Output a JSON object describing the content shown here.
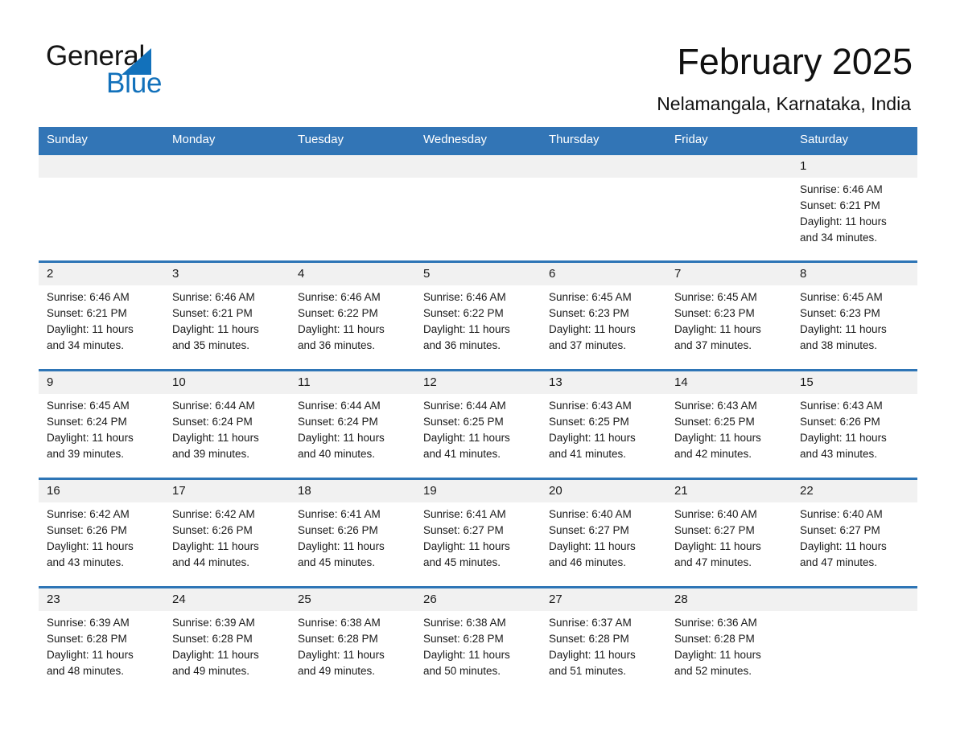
{
  "logo": {
    "word_one": "General",
    "word_two": "Blue",
    "triangle_color": "#1271bb"
  },
  "header": {
    "title": "February 2025",
    "subtitle": "Nelamangala, Karnataka, India",
    "accent_color": "#3275b6",
    "daynum_bg": "#f1f1f1"
  },
  "weekday_headers": [
    "Sunday",
    "Monday",
    "Tuesday",
    "Wednesday",
    "Thursday",
    "Friday",
    "Saturday"
  ],
  "labels": {
    "sunrise_prefix": "Sunrise:",
    "sunset_prefix": "Sunset:",
    "daylight_prefix": "Daylight:"
  },
  "weeks": [
    [
      {
        "day": "",
        "blank": true
      },
      {
        "day": "",
        "blank": true
      },
      {
        "day": "",
        "blank": true
      },
      {
        "day": "",
        "blank": true
      },
      {
        "day": "",
        "blank": true
      },
      {
        "day": "",
        "blank": true
      },
      {
        "day": "1",
        "sunrise": "Sunrise: 6:46 AM",
        "sunset": "Sunset: 6:21 PM",
        "daylight_l1": "Daylight: 11 hours",
        "daylight_l2": "and 34 minutes."
      }
    ],
    [
      {
        "day": "2",
        "sunrise": "Sunrise: 6:46 AM",
        "sunset": "Sunset: 6:21 PM",
        "daylight_l1": "Daylight: 11 hours",
        "daylight_l2": "and 34 minutes."
      },
      {
        "day": "3",
        "sunrise": "Sunrise: 6:46 AM",
        "sunset": "Sunset: 6:21 PM",
        "daylight_l1": "Daylight: 11 hours",
        "daylight_l2": "and 35 minutes."
      },
      {
        "day": "4",
        "sunrise": "Sunrise: 6:46 AM",
        "sunset": "Sunset: 6:22 PM",
        "daylight_l1": "Daylight: 11 hours",
        "daylight_l2": "and 36 minutes."
      },
      {
        "day": "5",
        "sunrise": "Sunrise: 6:46 AM",
        "sunset": "Sunset: 6:22 PM",
        "daylight_l1": "Daylight: 11 hours",
        "daylight_l2": "and 36 minutes."
      },
      {
        "day": "6",
        "sunrise": "Sunrise: 6:45 AM",
        "sunset": "Sunset: 6:23 PM",
        "daylight_l1": "Daylight: 11 hours",
        "daylight_l2": "and 37 minutes."
      },
      {
        "day": "7",
        "sunrise": "Sunrise: 6:45 AM",
        "sunset": "Sunset: 6:23 PM",
        "daylight_l1": "Daylight: 11 hours",
        "daylight_l2": "and 37 minutes."
      },
      {
        "day": "8",
        "sunrise": "Sunrise: 6:45 AM",
        "sunset": "Sunset: 6:23 PM",
        "daylight_l1": "Daylight: 11 hours",
        "daylight_l2": "and 38 minutes."
      }
    ],
    [
      {
        "day": "9",
        "sunrise": "Sunrise: 6:45 AM",
        "sunset": "Sunset: 6:24 PM",
        "daylight_l1": "Daylight: 11 hours",
        "daylight_l2": "and 39 minutes."
      },
      {
        "day": "10",
        "sunrise": "Sunrise: 6:44 AM",
        "sunset": "Sunset: 6:24 PM",
        "daylight_l1": "Daylight: 11 hours",
        "daylight_l2": "and 39 minutes."
      },
      {
        "day": "11",
        "sunrise": "Sunrise: 6:44 AM",
        "sunset": "Sunset: 6:24 PM",
        "daylight_l1": "Daylight: 11 hours",
        "daylight_l2": "and 40 minutes."
      },
      {
        "day": "12",
        "sunrise": "Sunrise: 6:44 AM",
        "sunset": "Sunset: 6:25 PM",
        "daylight_l1": "Daylight: 11 hours",
        "daylight_l2": "and 41 minutes."
      },
      {
        "day": "13",
        "sunrise": "Sunrise: 6:43 AM",
        "sunset": "Sunset: 6:25 PM",
        "daylight_l1": "Daylight: 11 hours",
        "daylight_l2": "and 41 minutes."
      },
      {
        "day": "14",
        "sunrise": "Sunrise: 6:43 AM",
        "sunset": "Sunset: 6:25 PM",
        "daylight_l1": "Daylight: 11 hours",
        "daylight_l2": "and 42 minutes."
      },
      {
        "day": "15",
        "sunrise": "Sunrise: 6:43 AM",
        "sunset": "Sunset: 6:26 PM",
        "daylight_l1": "Daylight: 11 hours",
        "daylight_l2": "and 43 minutes."
      }
    ],
    [
      {
        "day": "16",
        "sunrise": "Sunrise: 6:42 AM",
        "sunset": "Sunset: 6:26 PM",
        "daylight_l1": "Daylight: 11 hours",
        "daylight_l2": "and 43 minutes."
      },
      {
        "day": "17",
        "sunrise": "Sunrise: 6:42 AM",
        "sunset": "Sunset: 6:26 PM",
        "daylight_l1": "Daylight: 11 hours",
        "daylight_l2": "and 44 minutes."
      },
      {
        "day": "18",
        "sunrise": "Sunrise: 6:41 AM",
        "sunset": "Sunset: 6:26 PM",
        "daylight_l1": "Daylight: 11 hours",
        "daylight_l2": "and 45 minutes."
      },
      {
        "day": "19",
        "sunrise": "Sunrise: 6:41 AM",
        "sunset": "Sunset: 6:27 PM",
        "daylight_l1": "Daylight: 11 hours",
        "daylight_l2": "and 45 minutes."
      },
      {
        "day": "20",
        "sunrise": "Sunrise: 6:40 AM",
        "sunset": "Sunset: 6:27 PM",
        "daylight_l1": "Daylight: 11 hours",
        "daylight_l2": "and 46 minutes."
      },
      {
        "day": "21",
        "sunrise": "Sunrise: 6:40 AM",
        "sunset": "Sunset: 6:27 PM",
        "daylight_l1": "Daylight: 11 hours",
        "daylight_l2": "and 47 minutes."
      },
      {
        "day": "22",
        "sunrise": "Sunrise: 6:40 AM",
        "sunset": "Sunset: 6:27 PM",
        "daylight_l1": "Daylight: 11 hours",
        "daylight_l2": "and 47 minutes."
      }
    ],
    [
      {
        "day": "23",
        "sunrise": "Sunrise: 6:39 AM",
        "sunset": "Sunset: 6:28 PM",
        "daylight_l1": "Daylight: 11 hours",
        "daylight_l2": "and 48 minutes."
      },
      {
        "day": "24",
        "sunrise": "Sunrise: 6:39 AM",
        "sunset": "Sunset: 6:28 PM",
        "daylight_l1": "Daylight: 11 hours",
        "daylight_l2": "and 49 minutes."
      },
      {
        "day": "25",
        "sunrise": "Sunrise: 6:38 AM",
        "sunset": "Sunset: 6:28 PM",
        "daylight_l1": "Daylight: 11 hours",
        "daylight_l2": "and 49 minutes."
      },
      {
        "day": "26",
        "sunrise": "Sunrise: 6:38 AM",
        "sunset": "Sunset: 6:28 PM",
        "daylight_l1": "Daylight: 11 hours",
        "daylight_l2": "and 50 minutes."
      },
      {
        "day": "27",
        "sunrise": "Sunrise: 6:37 AM",
        "sunset": "Sunset: 6:28 PM",
        "daylight_l1": "Daylight: 11 hours",
        "daylight_l2": "and 51 minutes."
      },
      {
        "day": "28",
        "sunrise": "Sunrise: 6:36 AM",
        "sunset": "Sunset: 6:28 PM",
        "daylight_l1": "Daylight: 11 hours",
        "daylight_l2": "and 52 minutes."
      },
      {
        "day": "",
        "blank": true
      }
    ]
  ]
}
